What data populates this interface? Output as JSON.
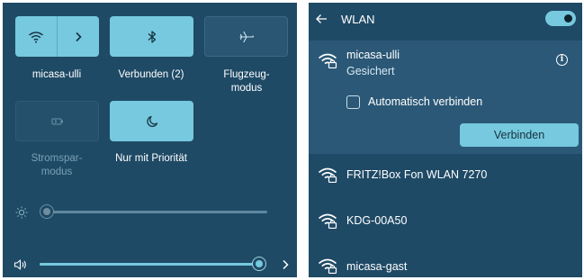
{
  "quick_settings": {
    "tiles": [
      {
        "id": "wifi",
        "label": "micasa-ulli",
        "state": "on",
        "icon": "wifi-icon",
        "secondary_icon": "chevron-right-icon"
      },
      {
        "id": "bluetooth",
        "label": "Verbunden (2)",
        "state": "on",
        "icon": "bluetooth-icon"
      },
      {
        "id": "airplane",
        "label": "Flugzeug-\nmodus",
        "state": "off",
        "icon": "airplane-icon"
      },
      {
        "id": "battery_saver",
        "label": "Stromspar-\nmodus",
        "state": "disabled",
        "icon": "battery-saver-icon"
      },
      {
        "id": "focus",
        "label": "Nur mit Priorität",
        "state": "on",
        "icon": "moon-icon"
      }
    ],
    "brightness": {
      "icon": "sun-icon",
      "level": 0
    },
    "volume": {
      "icon": "speaker-icon",
      "level": 1.0,
      "chevron_icon": "chevron-right-icon"
    }
  },
  "wlan_panel": {
    "title": "WLAN",
    "back_icon": "back-arrow-icon",
    "wifi_enabled": true,
    "selected_network": {
      "name": "micasa-ulli",
      "status": "Gesichert",
      "auto_connect_label": "Automatisch verbinden",
      "auto_connect_checked": false,
      "connect_button_label": "Verbinden",
      "info_icon": "info-icon",
      "info_glyph": "i"
    },
    "networks": [
      {
        "name": "FRITZ!Box Fon WLAN 7270"
      },
      {
        "name": "KDG-00A50"
      },
      {
        "name": "micasa-gast"
      }
    ]
  },
  "colors": {
    "panel_bg": "#1f4a66",
    "accent": "#76c9de",
    "selected_bg": "#2b5876",
    "text": "#ffffff"
  }
}
